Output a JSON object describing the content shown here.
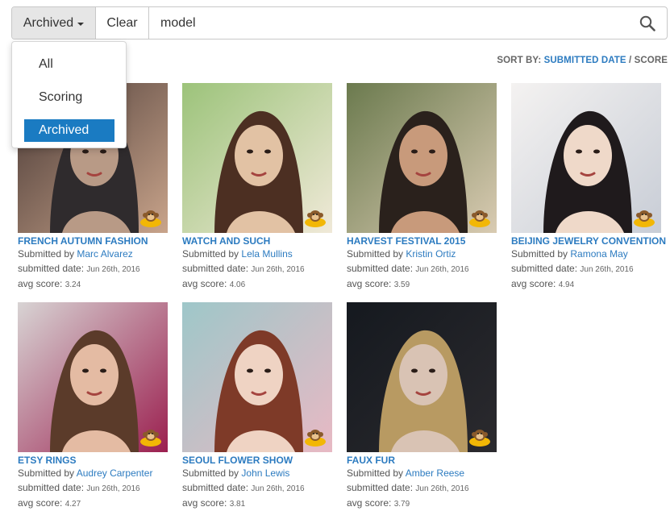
{
  "search": {
    "filter_label": "Archived",
    "clear_label": "Clear",
    "query": "model"
  },
  "dropdown": {
    "items": [
      {
        "label": "All"
      },
      {
        "label": "Scoring"
      },
      {
        "label": "Archived"
      }
    ],
    "selected": "Archived"
  },
  "sort": {
    "prefix": "SORT BY:",
    "active_option": "SUBMITTED DATE",
    "separator": "/",
    "other_option": "SCORE"
  },
  "labels": {
    "submitted_by": "Submitted by",
    "submitted_date": "submitted date:",
    "avg_score": "avg score:"
  },
  "colors": {
    "link": "#2c7bc0",
    "selected_item_bg": "#1a7bc2"
  },
  "entries": [
    {
      "title": "FRENCH AUTUMN FASHION",
      "author": "Marc Alvarez",
      "date": "Jun 26th, 2016",
      "score": "3.24"
    },
    {
      "title": "WATCH AND SUCH",
      "author": "Lela Mullins",
      "date": "Jun 26th, 2016",
      "score": "4.06"
    },
    {
      "title": "HARVEST FESTIVAL 2015",
      "author": "Kristin Ortiz",
      "date": "Jun 26th, 2016",
      "score": "3.59"
    },
    {
      "title": "BEIJING JEWELRY CONVENTION",
      "author": "Ramona May",
      "date": "Jun 26th, 2016",
      "score": "4.94"
    },
    {
      "title": "ETSY RINGS",
      "author": "Audrey Carpenter",
      "date": "Jun 26th, 2016",
      "score": "4.27"
    },
    {
      "title": "SEOUL FLOWER SHOW",
      "author": "John Lewis",
      "date": "Jun 26th, 2016",
      "score": "3.81"
    },
    {
      "title": "FAUX FUR",
      "author": "Amber Reese",
      "date": "Jun 26th, 2016",
      "score": "3.79"
    }
  ]
}
